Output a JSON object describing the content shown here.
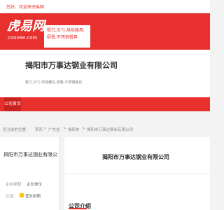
{
  "topbar": {
    "notice": "您好，欢迎来虎易网"
  },
  "header": {
    "logo_main": "虎易网",
    "logo_sub": "coovee.com",
    "tagline": "餐刀,叉勺,烘焙器具,厨餐,不锈钢餐具"
  },
  "company": {
    "name": "揭阳市万事达钢业有限公司",
    "desc": "餐刀,叉勺,烘焙器具,厨餐,不锈钢餐具"
  },
  "nav": {
    "home_tab": "公司首页"
  },
  "breadcrumb": {
    "items": [
      "您当前的位置:",
      "首页",
      ">",
      "广东省",
      ">",
      "揭阳市",
      ">",
      "揭阳市万事达钢业有限公司"
    ]
  },
  "sidebar": {
    "company": "揭阳市万事达钢业有限公司",
    "enterprise_type_label": "企业类型:",
    "enterprise_type_value": "企业单位",
    "auth_label": "认证:",
    "auth_value": "营业执照",
    "icon_colors": {
      "auth": "#ffc107"
    }
  },
  "main": {
    "title": "揭阳市万事达钢业有限公司",
    "intro_heading": "公司介绍"
  },
  "colors": {
    "brand": "#e8312f",
    "nav_active": "#c8221f"
  }
}
